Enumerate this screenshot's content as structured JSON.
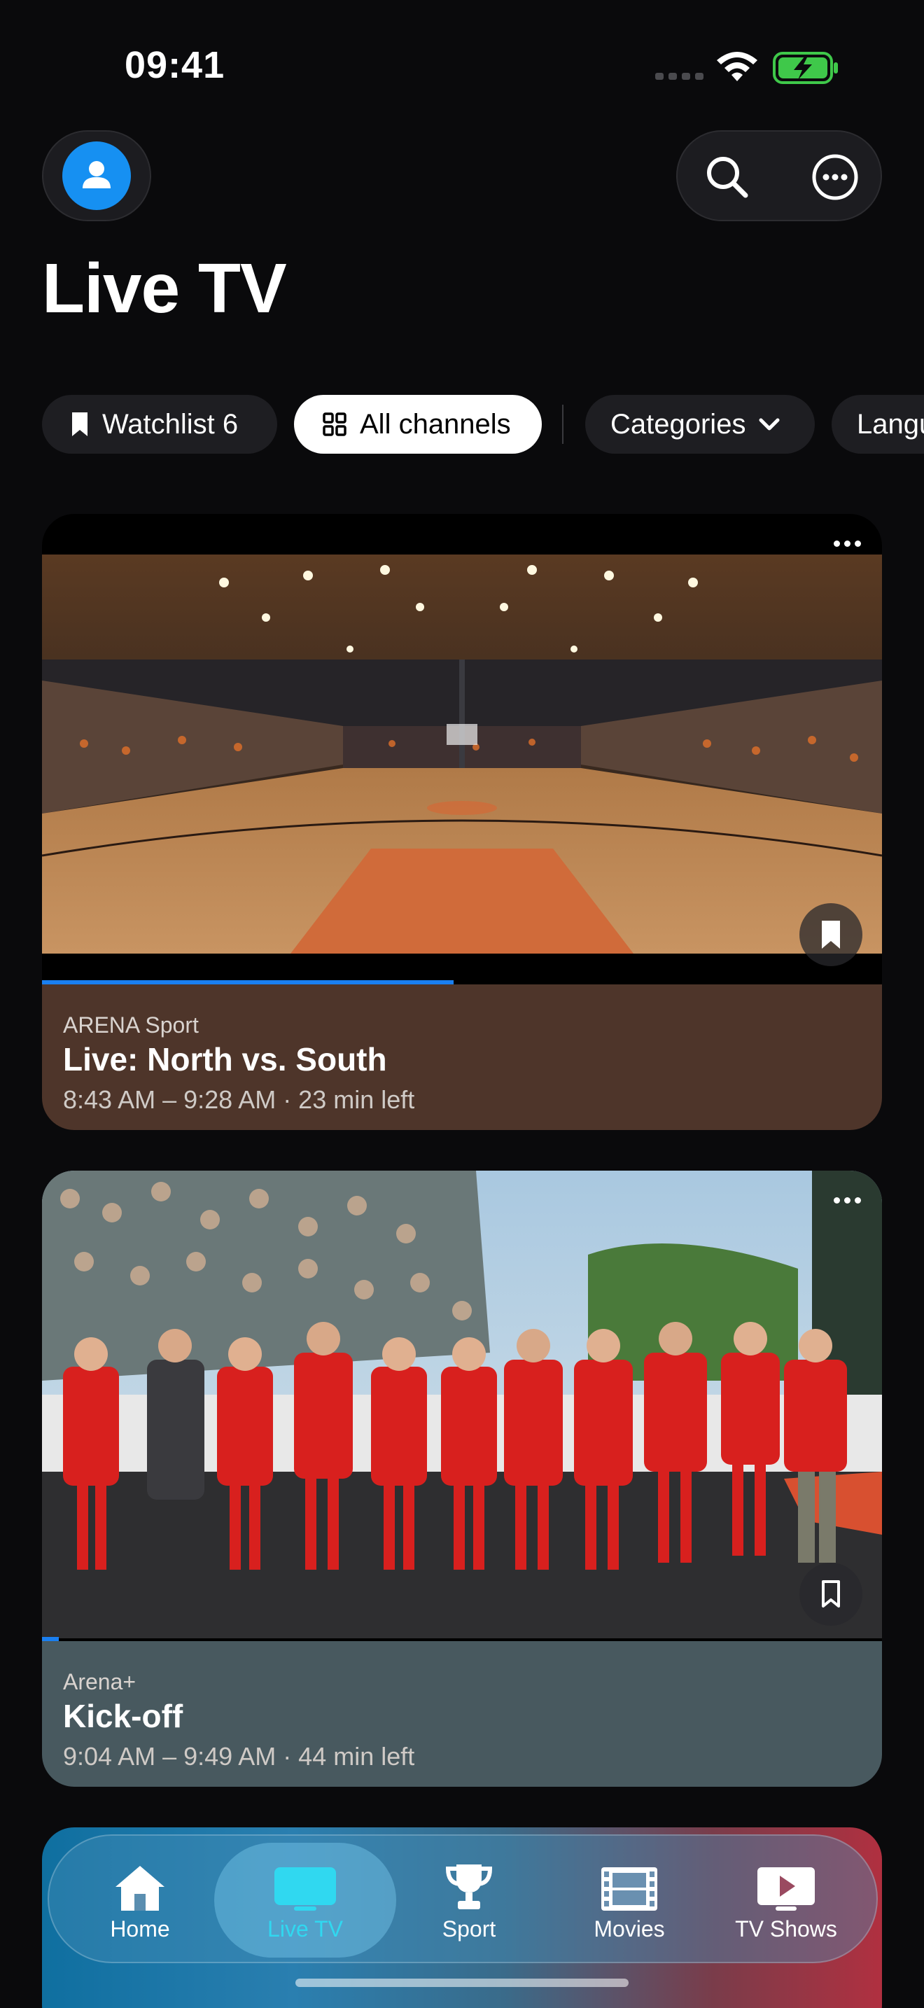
{
  "status_bar": {
    "time": "09:41"
  },
  "header": {
    "title": "Live TV"
  },
  "filters": {
    "watchlist_label": "Watchlist 6",
    "all_channels_label": "All channels",
    "categories_label": "Categories",
    "languages_label": "Langu"
  },
  "cards": [
    {
      "channel": "ARENA Sport",
      "title": "Live: North vs. South",
      "time": "8:43 AM – 9:28 AM · 23 min left",
      "progress": 0.49
    },
    {
      "channel": "Arena+",
      "title": "Kick-off",
      "time": "9:04 AM – 9:49 AM · 44 min left",
      "progress": 0.02
    }
  ],
  "tabbar": {
    "items": [
      {
        "label": "Home",
        "icon": "house-icon"
      },
      {
        "label": "Live TV",
        "icon": "tv-icon",
        "selected": true
      },
      {
        "label": "Sport",
        "icon": "trophy-icon"
      },
      {
        "label": "Movies",
        "icon": "film-icon"
      },
      {
        "label": "TV Shows",
        "icon": "play-rectangle-icon"
      }
    ]
  },
  "colors": {
    "accent": "#1a7ff0",
    "selected_tab": "#30d8f0",
    "background": "#0a0a0c"
  }
}
